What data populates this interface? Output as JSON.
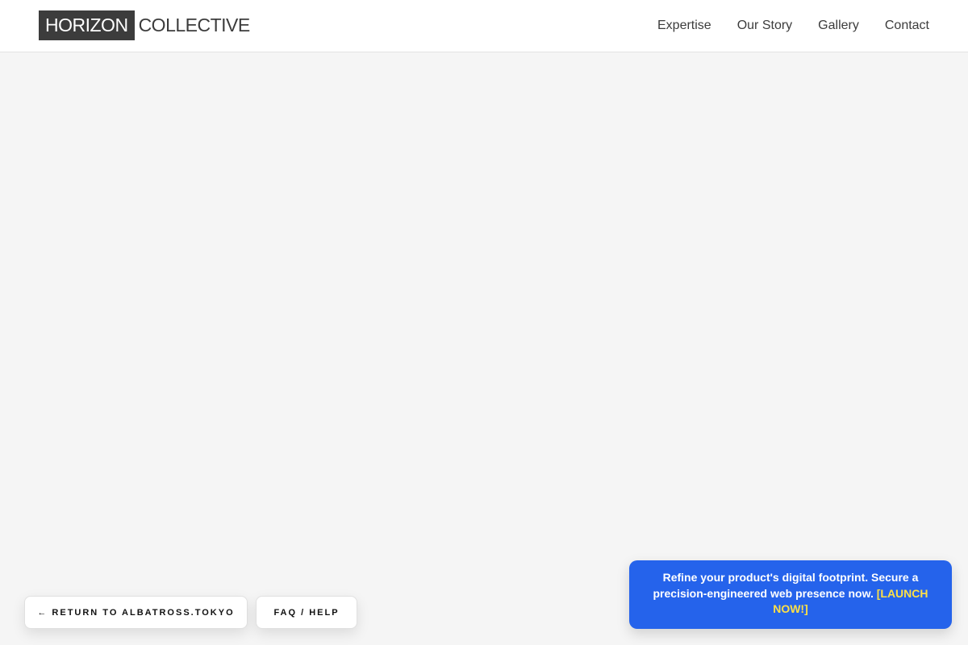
{
  "header": {
    "logo_box": "HORIZON",
    "logo_rest": "COLLECTIVE",
    "nav": [
      {
        "label": "Expertise"
      },
      {
        "label": "Our Story"
      },
      {
        "label": "Gallery"
      },
      {
        "label": "Contact"
      }
    ]
  },
  "buttons": {
    "return_label": "← RETURN TO ALBATROSS.TOKYO",
    "faq_label": "FAQ / HELP"
  },
  "promo": {
    "text": "Refine your product's digital footprint. Secure a precision-engineered web presence now.",
    "link_label": "[LAUNCH NOW!]"
  },
  "colors": {
    "background": "#f5f5f5",
    "header_bg": "#ffffff",
    "logo_box": "#3c3c3c",
    "promo_bg": "#2563eb",
    "promo_link": "#fde047"
  }
}
